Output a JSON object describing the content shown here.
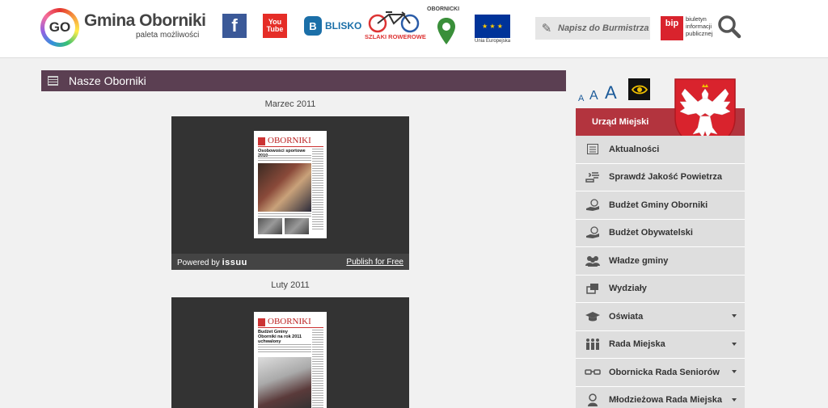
{
  "header": {
    "logo_letters": "GO",
    "logo_title": "Gmina Oborniki",
    "logo_subtitle": "paleta możliwości",
    "facebook_icon": "facebook-icon",
    "youtube_label": "You Tube",
    "blisko_letter": "B",
    "blisko_label": "BLISKO",
    "szlaki_label": "SZLAKI ROWEROWE",
    "obornicki_label": "OBORNICKI",
    "eu_label": "Unia Europejska",
    "napisz_label": "Napisz do Burmistrza",
    "bip_letters": "bip",
    "bip_text": "biuletyn informacji publicznej",
    "search_icon": "search-icon"
  },
  "main": {
    "section_title": "Nasze Oborniki",
    "publications": [
      {
        "caption": "Marzec 2011",
        "masthead": "OBORNIKI",
        "headline": "Osobowości sportowe 2010",
        "powered_by": "Powered by",
        "brand": "issuu",
        "publish_label": "Publish for Free"
      },
      {
        "caption": "Luty 2011",
        "masthead": "OBORNIKI",
        "headline": "Budżet Gminy Oborniki na rok 2011 uchwalony"
      }
    ]
  },
  "sidebar": {
    "font_sizes": [
      "A",
      "A",
      "A"
    ],
    "urzad_label": "Urząd Miejski",
    "menu": [
      {
        "label": "Aktualności",
        "icon": "newspaper-icon",
        "submenu": false
      },
      {
        "label": "Sprawdź Jakość Powietrza",
        "icon": "air-quality-icon",
        "submenu": false
      },
      {
        "label": "Budżet Gminy Oborniki",
        "icon": "money-hand-icon",
        "submenu": false
      },
      {
        "label": "Budżet Obywatelski",
        "icon": "money-hand-icon",
        "submenu": false
      },
      {
        "label": "Władze gminy",
        "icon": "users-icon",
        "submenu": false
      },
      {
        "label": "Wydziały",
        "icon": "copy-icon",
        "submenu": false
      },
      {
        "label": "Oświata",
        "icon": "graduation-cap-icon",
        "submenu": true
      },
      {
        "label": "Rada Miejska",
        "icon": "people-group-icon",
        "submenu": true
      },
      {
        "label": "Obornicka Rada Seniorów",
        "icon": "glasses-icon",
        "submenu": true
      },
      {
        "label": "Młodzieżowa Rada Miejska",
        "icon": "youth-icon",
        "submenu": true
      }
    ]
  },
  "colors": {
    "title_bar": "#5b3f52",
    "urzad_bar": "#b3343e",
    "menu_bg": "#dedede",
    "link_blue": "#1b5a99"
  }
}
